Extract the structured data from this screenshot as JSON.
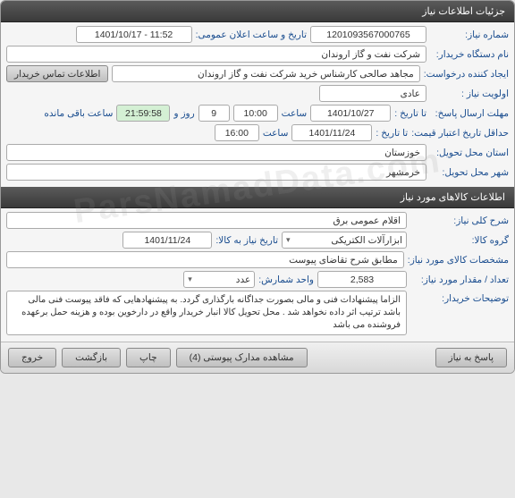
{
  "watermark": "ParsNamadData.com",
  "section1": {
    "title": "جزئیات اطلاعات نیاز",
    "need_number_label": "شماره نیاز:",
    "need_number": "1201093567000765",
    "announce_label": "تاریخ و ساعت اعلان عمومی:",
    "announce_value": "1401/10/17 - 11:52",
    "buyer_org_label": "نام دستگاه خریدار:",
    "buyer_org": "شرکت نفت و گاز اروندان",
    "requester_label": "ایجاد کننده درخواست:",
    "requester": "مجاهد صالحی کارشناس خرید شرکت نفت و گاز اروندان",
    "contact_btn": "اطلاعات تماس خریدار",
    "priority_label": "اولویت نیاز :",
    "priority": "عادی",
    "deadline_label": "مهلت ارسال پاسخ:",
    "to_date_label": "تا تاریخ :",
    "deadline_date": "1401/10/27",
    "time_label": "ساعت",
    "deadline_time": "10:00",
    "days_remain": "9",
    "days_word": "روز و",
    "countdown": "21:59:58",
    "remain_word": "ساعت باقی مانده",
    "validity_label": "حداقل تاریخ اعتبار قیمت:",
    "validity_date": "1401/11/24",
    "validity_time": "16:00",
    "province_label": "استان محل تحویل:",
    "province": "خوزستان",
    "city_label": "شهر محل تحویل:",
    "city": "خرمشهر"
  },
  "section2": {
    "title": "اطلاعات کالاهای مورد نیاز",
    "desc_label": "شرح کلی نیاز:",
    "desc": "اقلام عمومی برق",
    "group_label": "گروه کالا:",
    "group": "ابزارآلات الکتریکی",
    "need_by_label": "تاریخ نیاز به کالا:",
    "need_by": "1401/11/24",
    "spec_label": "مشخصات کالای مورد نیاز:",
    "spec": "مطابق شرح تقاضای پیوست",
    "qty_label": "تعداد / مقدار مورد نیاز:",
    "qty": "2,583",
    "unit_label": "واحد شمارش:",
    "unit": "عدد",
    "notes_label": "توضیحات خریدار:",
    "notes": "الزاما  پیشنهادات فنی و مالی بصورت جداگانه بارگذاری گردد. به پیشنهادهایی که فاقد پیوست فنی مالی باشد ترتیب اثر داده نخواهد شد .\nمحل تحویل کالا انبار خریدار واقع در  دارخوین بوده و هزینه حمل برعهده فروشنده می باشد"
  },
  "footer": {
    "respond": "پاسخ به نیاز",
    "attachments": "مشاهده مدارک پیوستی (4)",
    "print": "چاپ",
    "back": "بازگشت",
    "close": "خروج"
  }
}
